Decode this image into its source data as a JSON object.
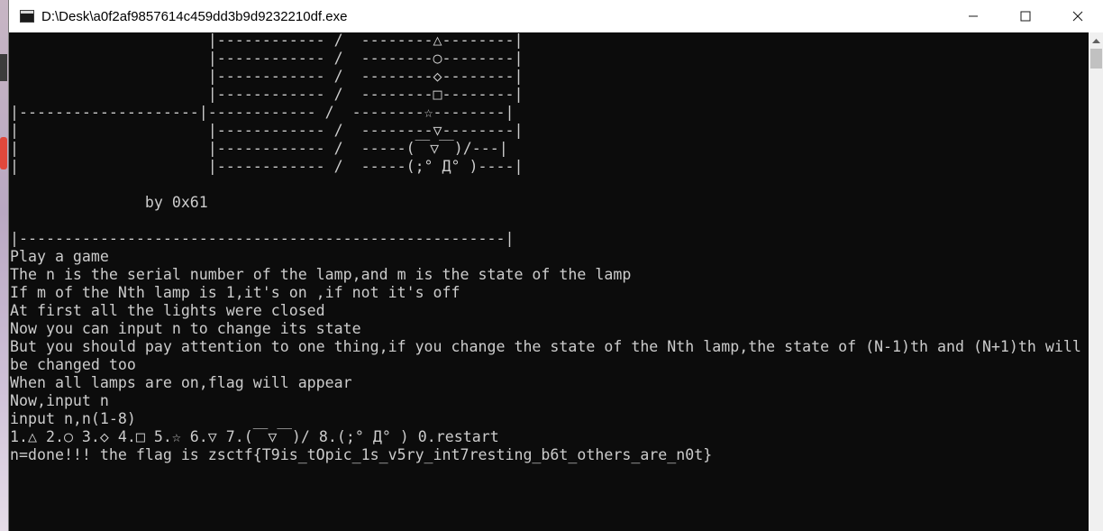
{
  "window": {
    "title": "D:\\Desk\\a0f2af9857614c459dd3b9d9232210df.exe"
  },
  "icons": {
    "app": "console-app-icon",
    "minimize": "minimize-icon",
    "maximize": "maximize-icon",
    "close": "close-icon",
    "scroll_up": "scroll-up-arrow-icon"
  },
  "console": {
    "lines": [
      "                      |------------ /  --------△--------|",
      "                      |------------ /  --------○--------|",
      "                      |------------ /  --------◇--------|",
      "                      |------------ /  --------□--------|",
      "|--------------------|------------ /  --------☆--------|",
      "|                     |------------ /  --------▽--------|",
      "|                     |------------ /  -----(￣▽￣)/---|",
      "|                     |------------ /  -----(;° Д° )----|",
      "",
      "               by 0x61",
      "",
      "|------------------------------------------------------|",
      "Play a game",
      "The n is the serial number of the lamp,and m is the state of the lamp",
      "If m of the Nth lamp is 1,it's on ,if not it's off",
      "At first all the lights were closed",
      "Now you can input n to change its state",
      "But you should pay attention to one thing,if you change the state of the Nth lamp,the state of (N-1)th and (N+1)th will",
      "be changed too",
      "When all lamps are on,flag will appear",
      "Now,input n",
      "input n,n(1-8)",
      "1.△ 2.○ 3.◇ 4.□ 5.☆ 6.▽ 7.(￣▽￣)/ 8.(;° Д° ) 0.restart",
      "n=done!!! the flag is zsctf{T9is_tOpic_1s_v5ry_int7resting_b6t_others_are_n0t}"
    ]
  }
}
